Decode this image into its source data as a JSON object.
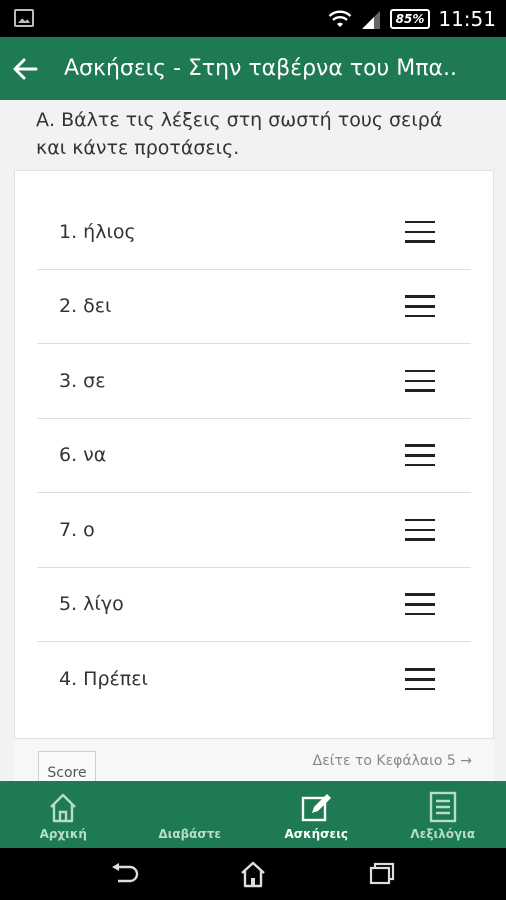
{
  "status_bar": {
    "battery": "85%",
    "time": "11:51"
  },
  "app_bar": {
    "title": "Ασκήσεις - Στην ταβέρνα του Μπα.."
  },
  "exercise": {
    "instruction": "Α. Βάλτε τις λέξεις στη σωστή τους σειρά και κάντε προτάσεις.",
    "items": [
      {
        "label": "1. ήλιος"
      },
      {
        "label": "2. δει"
      },
      {
        "label": "3. σε"
      },
      {
        "label": "6. να"
      },
      {
        "label": "7. ο"
      },
      {
        "label": "5. λίγο"
      },
      {
        "label": "4. Πρέπει"
      }
    ],
    "score_label": "Score",
    "chapter_link": "Δείτε το Κεφάλαιο 5 →"
  },
  "bottom_nav": [
    {
      "label": "Αρχική",
      "icon": "home-icon",
      "active": false
    },
    {
      "label": "Διαβάστε",
      "icon": "book-icon",
      "active": false
    },
    {
      "label": "Ασκήσεις",
      "icon": "edit-icon",
      "active": true
    },
    {
      "label": "Λεξιλόγια",
      "icon": "list-icon",
      "active": false
    }
  ],
  "colors": {
    "primary": "#1d7a52",
    "inactive_nav": "#b7dcc9"
  }
}
